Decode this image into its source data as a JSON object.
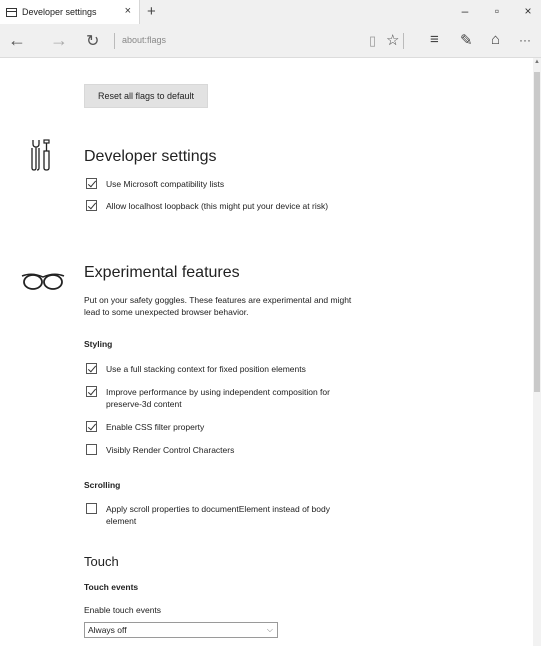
{
  "tab": {
    "title": "Developer settings",
    "close": "×",
    "new_tab": "+"
  },
  "window": {
    "minimize": "–",
    "maximize": "▫",
    "close": "×"
  },
  "nav": {
    "back": "←",
    "forward": "→",
    "refresh": "↻",
    "address": "about:flags",
    "reading_view": "▯",
    "favorite": "☆",
    "hub": "≡",
    "note": "✎",
    "share": "⌂",
    "more": "···"
  },
  "reset_label": "Reset all flags to default",
  "developer": {
    "title": "Developer settings",
    "options": [
      {
        "label": "Use Microsoft compatibility lists",
        "checked": true
      },
      {
        "label": "Allow localhost loopback (this might put your device at risk)",
        "checked": true
      }
    ]
  },
  "experimental": {
    "title": "Experimental features",
    "description": "Put on your safety goggles. These features are experimental and might lead to some unexpected browser behavior.",
    "styling": {
      "heading": "Styling",
      "options": [
        {
          "label": "Use a full stacking context for fixed position elements",
          "checked": true
        },
        {
          "label": "Improve performance by using independent composition for preserve-3d content",
          "checked": true
        },
        {
          "label": "Enable CSS filter property",
          "checked": true
        },
        {
          "label": "Visibly Render Control Characters",
          "checked": false
        }
      ]
    },
    "scrolling": {
      "heading": "Scrolling",
      "options": [
        {
          "label": "Apply scroll properties to documentElement instead of body element",
          "checked": false
        }
      ]
    }
  },
  "touch": {
    "title": "Touch",
    "events_heading": "Touch events",
    "enable_label": "Enable touch events",
    "select_value": "Always off"
  },
  "icons": {
    "tools": "wrench-screwdriver-icon",
    "goggles": "goggles-icon",
    "dropdown": "chevron-down-icon"
  }
}
